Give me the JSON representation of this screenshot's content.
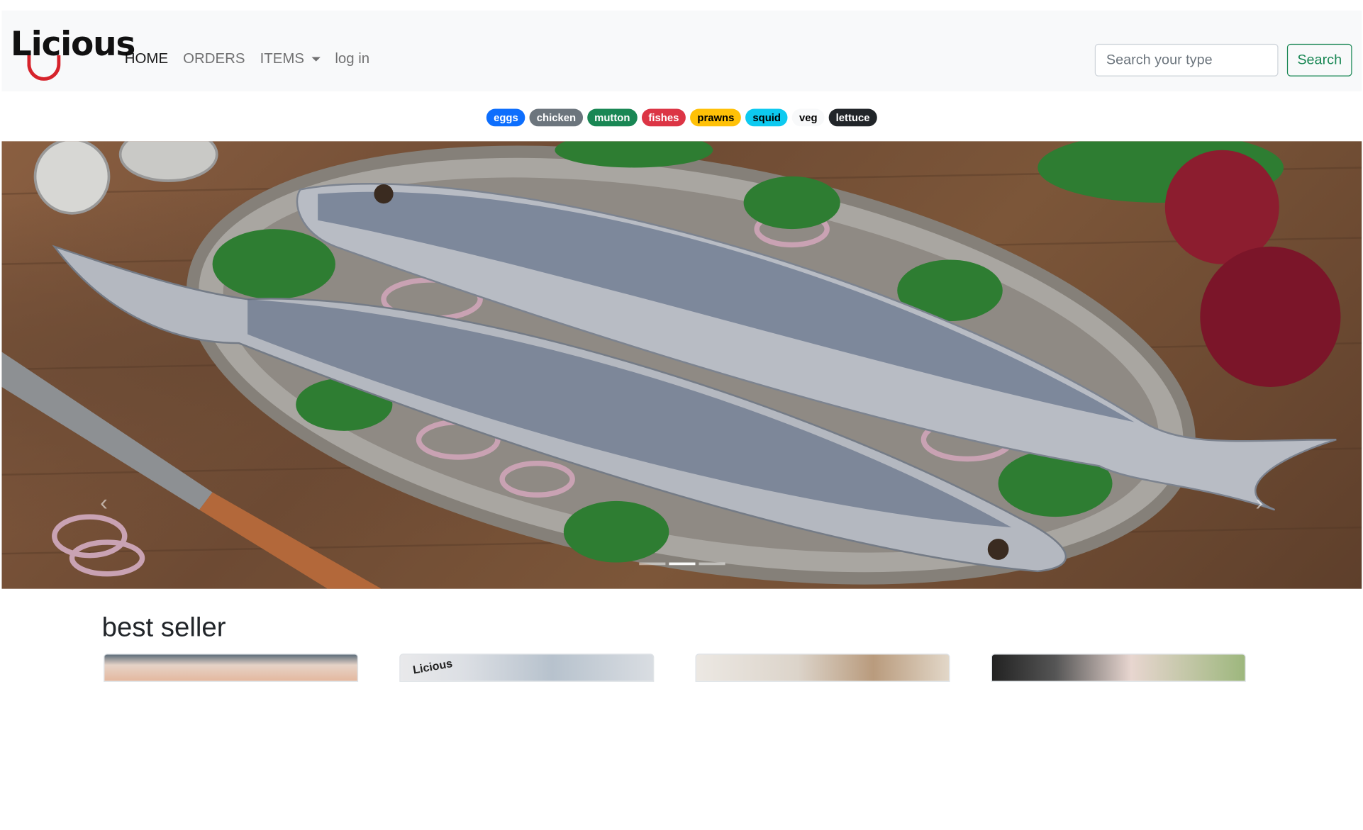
{
  "brand": {
    "logo_text": "Licious"
  },
  "nav": {
    "items": [
      {
        "label": "HOME",
        "active": true
      },
      {
        "label": "ORDERS",
        "active": false
      },
      {
        "label": "ITEMS",
        "active": false,
        "dropdown": true
      },
      {
        "label": "log in",
        "active": false
      }
    ]
  },
  "search": {
    "placeholder": "Search your type",
    "button_label": "Search"
  },
  "categories": [
    {
      "label": "eggs",
      "bg": "#0d6efd",
      "fg": "#ffffff"
    },
    {
      "label": "chicken",
      "bg": "#6c757d",
      "fg": "#ffffff"
    },
    {
      "label": "mutton",
      "bg": "#198754",
      "fg": "#ffffff"
    },
    {
      "label": "fishes",
      "bg": "#dc3545",
      "fg": "#ffffff"
    },
    {
      "label": "prawns",
      "bg": "#ffc107",
      "fg": "#000000"
    },
    {
      "label": "squid",
      "bg": "#0dcaf0",
      "fg": "#000000"
    },
    {
      "label": "veg",
      "bg": "#f8f9fa",
      "fg": "#000000"
    },
    {
      "label": "lettuce",
      "bg": "#212529",
      "fg": "#ffffff"
    }
  ],
  "hero": {
    "subject": "two fish on a silver platter with onions and parsley",
    "slides": 3,
    "active_slide": 1
  },
  "best_seller": {
    "title": "best seller",
    "cards": [
      {
        "subject": "prawns"
      },
      {
        "subject": "licious packaged product"
      },
      {
        "subject": "curry dish"
      },
      {
        "subject": "fish fillet with greens"
      }
    ]
  }
}
